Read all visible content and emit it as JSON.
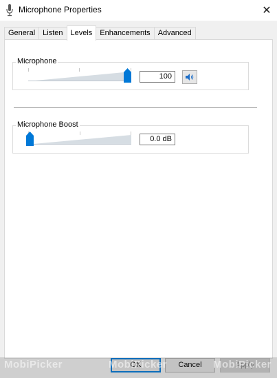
{
  "window": {
    "title": "Microphone Properties",
    "close_glyph": "✕"
  },
  "tabs": [
    {
      "label": "General"
    },
    {
      "label": "Listen"
    },
    {
      "label": "Levels",
      "active": true
    },
    {
      "label": "Enhancements"
    },
    {
      "label": "Advanced"
    }
  ],
  "microphone": {
    "label": "Microphone",
    "value": "100",
    "level_fraction": 1.0,
    "mute_icon": "speaker-icon"
  },
  "boost": {
    "label": "Microphone Boost",
    "value": "0.0 dB",
    "level_fraction": 0.0
  },
  "footer": {
    "ok_label": "OK",
    "cancel_label": "Cancel",
    "apply_label": "Apply"
  },
  "watermark": {
    "text": "MobiPicker"
  },
  "colors": {
    "accent": "#0078d7",
    "thumb": "#0078d7"
  }
}
